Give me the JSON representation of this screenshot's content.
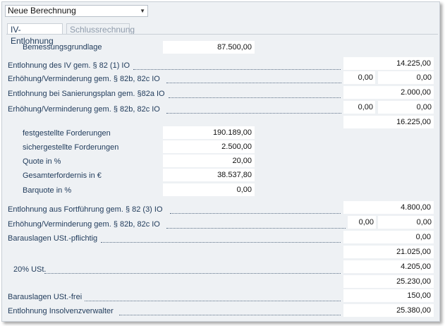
{
  "header": {
    "dropdown_value": "Neue Berechnung"
  },
  "tabs": [
    {
      "label": "IV-Entlohnung",
      "active": true
    },
    {
      "label": "Schlussrechnung",
      "active": false
    }
  ],
  "rows": {
    "bemessungsgrundlage": {
      "label": "Bemessungsgrundlage",
      "value": "87.500,00"
    },
    "entlohnung_iv": {
      "label": "Entlohnung des IV gem. § 82 (1) IO",
      "value": "14.225,00"
    },
    "erhoehung1": {
      "label": "Erhöhung/Verminderung gem. § 82b, 82c IO",
      "pct": "0,00",
      "value": "0,00"
    },
    "sanierungsplan": {
      "label": "Entlohnung bei Sanierungsplan gem. §82a IO",
      "value": "2.000,00"
    },
    "erhoehung2": {
      "label": "Erhöhung/Verminderung gem. § 82b, 82c IO",
      "pct": "0,00",
      "value": "0,00"
    },
    "zwischensumme1": {
      "value": "16.225,00"
    },
    "festgestellte": {
      "label": "festgestellte Forderungen",
      "value": "190.189,00"
    },
    "sichergestellte": {
      "label": "sichergestellte Forderungen",
      "value": "2.500,00"
    },
    "quote": {
      "label": "Quote in %",
      "value": "20,00"
    },
    "gesamterfordernis": {
      "label": "Gesamterfordernis in €",
      "value": "38.537,80"
    },
    "barquote": {
      "label": "Barquote in %",
      "value": "0,00"
    },
    "fortfuehrung": {
      "label": "Entlohnung aus Fortführung gem. § 82 (3) IO",
      "value": "4.800,00"
    },
    "erhoehung3": {
      "label": "Erhöhung/Verminderung gem. § 82b, 82c IO",
      "pct": "0,00",
      "value": "0,00"
    },
    "barauslagen_pflichtig": {
      "label": "Barauslagen USt.-pflichtig",
      "value": "0,00"
    },
    "zwischensumme2": {
      "value": "21.025,00"
    },
    "ust": {
      "label": "20% USt.",
      "value": "4.205,00"
    },
    "zwischensumme3": {
      "value": "25.230,00"
    },
    "barauslagen_frei": {
      "label": "Barauslagen USt.-frei",
      "value": "150,00"
    },
    "entlohnung_verwalter": {
      "label": "Entlohnung Insolvenzverwalter",
      "value": "25.380,00"
    }
  }
}
